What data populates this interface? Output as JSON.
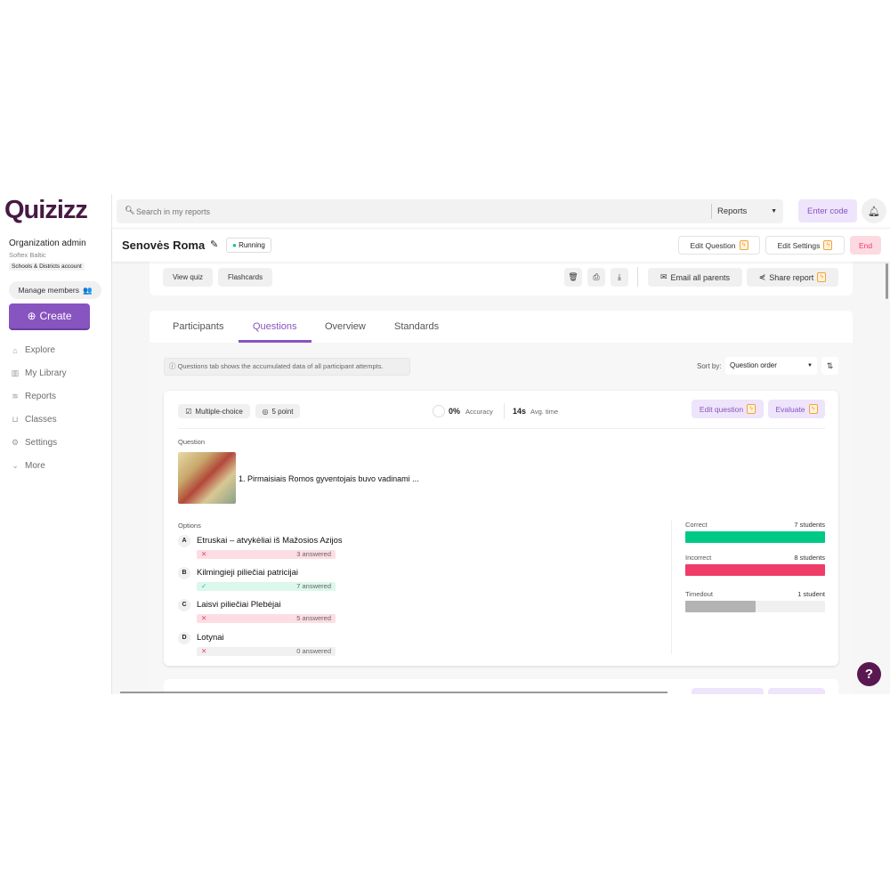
{
  "brand": {
    "logo": "Quizizz",
    "color": "#461a42",
    "accent": "#8854c0"
  },
  "sidebar": {
    "role": "Organization admin",
    "org": "Softex Baltic",
    "account_badge": "Schools & Districts account",
    "manage_members": "Manage members",
    "create": "Create",
    "items": [
      {
        "label": "Explore",
        "icon": "explore-icon"
      },
      {
        "label": "My Library",
        "icon": "library-icon"
      },
      {
        "label": "Reports",
        "icon": "reports-icon"
      },
      {
        "label": "Classes",
        "icon": "classes-icon"
      },
      {
        "label": "Settings",
        "icon": "settings-icon"
      },
      {
        "label": "More",
        "icon": "chevron-down-icon"
      }
    ]
  },
  "topbar": {
    "search_placeholder": "Search in my reports",
    "scope": "Reports",
    "enter_code": "Enter code"
  },
  "header": {
    "title": "Senovės Roma",
    "status": "Running",
    "edit_question": "Edit Question",
    "edit_settings": "Edit Settings",
    "end": "End"
  },
  "toolbar": {
    "view_quiz": "View quiz",
    "flashcards": "Flashcards",
    "email_parents": "Email all parents",
    "share_report": "Share report"
  },
  "tabs": [
    {
      "label": "Participants"
    },
    {
      "label": "Questions",
      "active": true
    },
    {
      "label": "Overview"
    },
    {
      "label": "Standards"
    }
  ],
  "info": "Questions tab shows the accumulated data of all participant attempts.",
  "sort": {
    "label": "Sort by:",
    "value": "Question order"
  },
  "question": {
    "type": "Multiple-choice",
    "points": "5 point",
    "accuracy": "0%",
    "accuracy_label": "Accuracy",
    "avg_time": "14s",
    "avg_time_label": "Avg. time",
    "edit": "Edit question",
    "evaluate": "Evaluate",
    "section_label": "Question",
    "text": "1. Pirmaisiais Romos gyventojais buvo vadinami ...",
    "options_label": "Options",
    "options": [
      {
        "letter": "A",
        "text": "Etruskai – atvykėliai iš Mažosios Azijos",
        "answered": "3 answered",
        "correct": false
      },
      {
        "letter": "B",
        "text": "Kilmingieji piliečiai patricijai",
        "answered": "7 answered",
        "correct": true
      },
      {
        "letter": "C",
        "text": "Laisvi piliečiai Plebėjai",
        "answered": "5 answered",
        "correct": false
      },
      {
        "letter": "D",
        "text": "Lotynai",
        "answered": "0 answered",
        "correct": false
      }
    ],
    "stats": [
      {
        "label": "Correct",
        "value": "7 students",
        "fraction": 1.0,
        "color": "#00c985"
      },
      {
        "label": "Incorrect",
        "value": "8 students",
        "fraction": 1.0,
        "color": "#ef3c69"
      },
      {
        "label": "Timedout",
        "value": "1 student",
        "fraction": 0.5,
        "color": "#b3b3b3"
      }
    ]
  },
  "help": "?"
}
